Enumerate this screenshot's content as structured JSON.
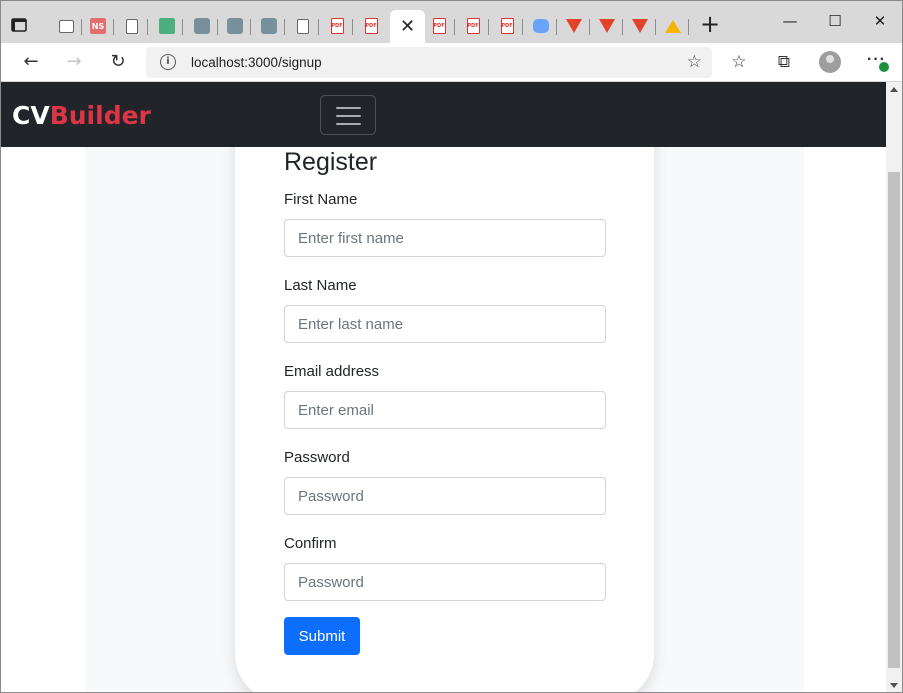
{
  "browser": {
    "tabs": [
      {
        "icon": "dashboard-icon"
      },
      {
        "icon": "ns-icon",
        "text": "NS"
      },
      {
        "icon": "doc-icon"
      },
      {
        "icon": "green-app-icon"
      },
      {
        "icon": "react-icon"
      },
      {
        "icon": "react-icon"
      },
      {
        "icon": "react-icon"
      },
      {
        "icon": "doc-settings-icon"
      },
      {
        "icon": "pdf-icon",
        "text": "PDF"
      },
      {
        "icon": "pdf-icon",
        "text": "PDF"
      },
      {
        "icon": "pdf-icon",
        "text": "PDF"
      },
      {
        "icon": "pdf-icon",
        "text": "PDF"
      },
      {
        "icon": "pdf-icon",
        "text": "PDF"
      },
      {
        "icon": "zoom-icon"
      },
      {
        "icon": "gitlab-icon"
      },
      {
        "icon": "gitlab-icon"
      },
      {
        "icon": "gitlab-icon"
      },
      {
        "icon": "drive-icon"
      }
    ],
    "active_tab_close": "✕",
    "new_tab": "+",
    "url": "localhost:3000/signup",
    "window_controls": {
      "minimize": "—",
      "maximize": "☐",
      "close": "✕"
    }
  },
  "app": {
    "brand_cv": "CV",
    "brand_builder": "Builder",
    "colors": {
      "navbar": "#212529",
      "brand_accent": "#dc3545",
      "primary": "#0d6efd"
    }
  },
  "form": {
    "title": "Register",
    "fields": [
      {
        "label": "First Name",
        "placeholder": "Enter first name",
        "value": ""
      },
      {
        "label": "Last Name",
        "placeholder": "Enter last name",
        "value": ""
      },
      {
        "label": "Email address",
        "placeholder": "Enter email",
        "value": ""
      },
      {
        "label": "Password",
        "placeholder": "Password",
        "value": ""
      },
      {
        "label": "Confirm",
        "placeholder": "Password",
        "value": ""
      }
    ],
    "submit_label": "Submit"
  }
}
